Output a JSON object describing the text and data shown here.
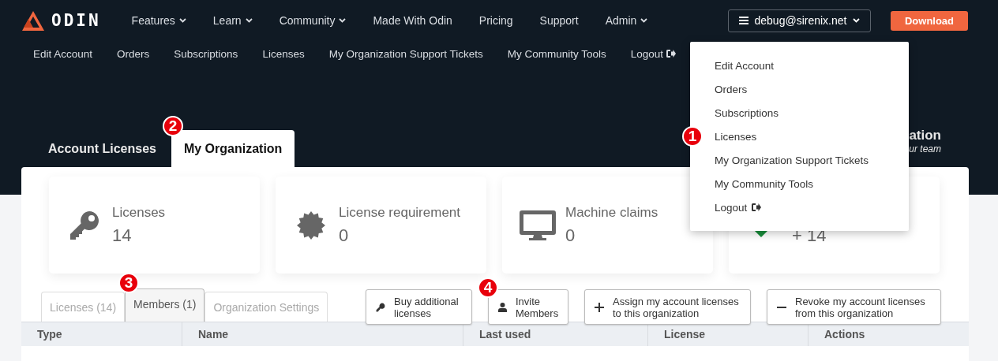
{
  "brand": {
    "name": "ODIN"
  },
  "nav": [
    {
      "label": "Features",
      "dropdown": true
    },
    {
      "label": "Learn",
      "dropdown": true
    },
    {
      "label": "Community",
      "dropdown": true
    },
    {
      "label": "Made With Odin",
      "dropdown": false
    },
    {
      "label": "Pricing",
      "dropdown": false
    },
    {
      "label": "Support",
      "dropdown": false
    },
    {
      "label": "Admin",
      "dropdown": true
    }
  ],
  "account_button": {
    "label": "debug@sirenix.net"
  },
  "download_button": {
    "label": "Download"
  },
  "subnav": [
    {
      "label": "Edit Account",
      "kind": "link"
    },
    {
      "label": "Orders",
      "kind": "link"
    },
    {
      "label": "Subscriptions",
      "kind": "link"
    },
    {
      "label": "Licenses",
      "kind": "link"
    },
    {
      "label": "My Organization Support Tickets",
      "kind": "link"
    },
    {
      "label": "My Community Tools",
      "kind": "link"
    },
    {
      "label": "Logout",
      "kind": "logout"
    }
  ],
  "page_tabs": [
    {
      "label": "Account Licenses",
      "selected": false
    },
    {
      "label": "My Organization",
      "selected": true,
      "badge": "2"
    }
  ],
  "hero": {
    "title": "ation",
    "subtitle": "ur team"
  },
  "stats": [
    {
      "label": "Licenses",
      "value": "14",
      "kind": "key"
    },
    {
      "label": "License requirement",
      "value": "0",
      "kind": "seal"
    },
    {
      "label": "Machine claims",
      "value": "0",
      "kind": "monitor"
    },
    {
      "value": "+ 14",
      "kind": "check"
    }
  ],
  "sub_tabs": [
    {
      "label": "Licenses (14)",
      "selected": false
    },
    {
      "label": "Members (1)",
      "selected": true,
      "badge": "3"
    },
    {
      "label": "Organization Settings",
      "selected": false
    }
  ],
  "actions": [
    {
      "label": "Buy additional licenses",
      "kind": "key"
    },
    {
      "label": "Invite Members",
      "kind": "user",
      "badge": "4"
    },
    {
      "label": "Assign my account licenses to this organization",
      "kind": "plus"
    },
    {
      "label": "Revoke my account licenses from this organization",
      "kind": "minus"
    }
  ],
  "table": {
    "columns": [
      "Type",
      "Name",
      "Last used",
      "License",
      "Actions"
    ]
  },
  "account_menu": {
    "items": [
      {
        "label": "Edit Account",
        "kind": "link"
      },
      {
        "label": "Orders",
        "kind": "link"
      },
      {
        "label": "Subscriptions",
        "kind": "link"
      },
      {
        "label": "Licenses",
        "kind": "link",
        "badge": "1"
      },
      {
        "label": "My Organization Support Tickets",
        "kind": "link"
      },
      {
        "label": "My Community Tools",
        "kind": "link"
      },
      {
        "label": "Logout",
        "kind": "logout"
      }
    ]
  }
}
